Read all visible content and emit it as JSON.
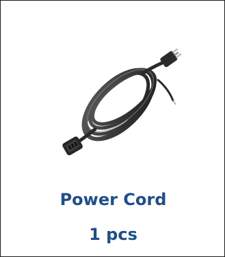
{
  "product": {
    "name": "Power Cord",
    "quantity": "1 pcs",
    "image_icon": "power-cord-image",
    "text_color": "#1f4e8c",
    "border_color": "#1a1a1a"
  }
}
